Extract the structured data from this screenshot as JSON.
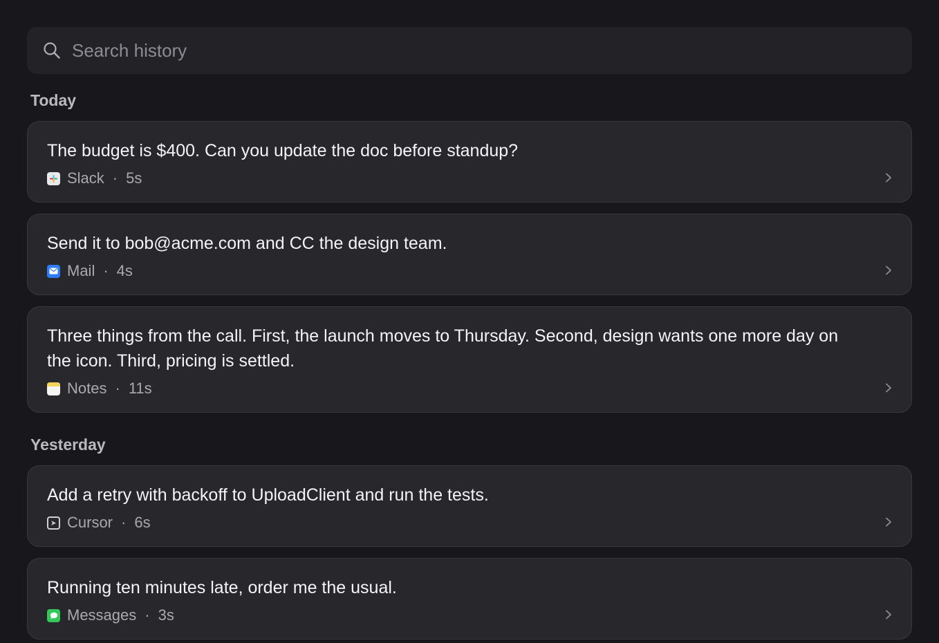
{
  "search": {
    "placeholder": "Search history",
    "icon": "search-icon"
  },
  "sections": {
    "today": {
      "label": "Today",
      "items": [
        {
          "text": "The budget is $400. Can you update the doc before standup?",
          "app": "Slack",
          "duration": "5s",
          "icon": "slack-icon"
        },
        {
          "text": "Send it to bob@acme.com and CC the design team.",
          "app": "Mail",
          "duration": "4s",
          "icon": "mail-icon"
        },
        {
          "text": "Three things from the call. First, the launch moves to Thursday. Second, design wants one more day on the icon. Third, pricing is settled.",
          "app": "Notes",
          "duration": "11s",
          "icon": "notes-icon"
        }
      ]
    },
    "yesterday": {
      "label": "Yesterday",
      "items": [
        {
          "text": "Add a retry with backoff to UploadClient and run the tests.",
          "app": "Cursor",
          "duration": "6s",
          "icon": "cursor-icon"
        },
        {
          "text": "Running ten minutes late, order me the usual.",
          "app": "Messages",
          "duration": "3s",
          "icon": "messages-icon"
        }
      ]
    }
  },
  "separator": "·",
  "colors": {
    "background": "#18181c",
    "card": "#28282c",
    "mail_blue": "#2f7cf6",
    "messages_green": "#34c759",
    "notes_yellow": "#f5d35a"
  }
}
